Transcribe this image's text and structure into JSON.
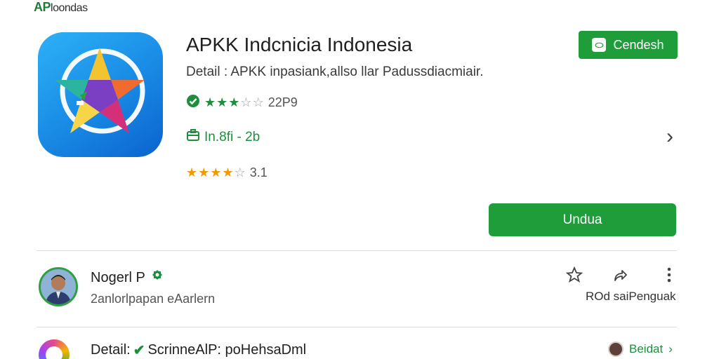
{
  "brand": {
    "accent": "AP",
    "rest": "loondas"
  },
  "app": {
    "title": "APKK Indcnicia Indonesia",
    "detail": "Detail : APKK inpasiank,allso llar Padussdiacmiair.",
    "rating1": {
      "stars_filled": 3,
      "stars_total": 5,
      "text": "22P9"
    },
    "info": "In.8fi - 2b",
    "rating2": {
      "stars_filled": 4,
      "stars_total": 5,
      "text": "3.1"
    }
  },
  "top_button": {
    "label": "Cendesh",
    "icon": "tag-icon"
  },
  "main_button": {
    "label": "Undua"
  },
  "developer": {
    "name": "Nogerl P",
    "subtitle": "2anlorlpapan eAarlern",
    "action_text": "ROd saiPenguak"
  },
  "bottom_row": {
    "prefix": "Detail:",
    "text": "ScrinneAlP: poHehsaDml",
    "right_label": "Beidat"
  },
  "colors": {
    "brand_green": "#1e9d3a",
    "star_orange": "#f29900",
    "icon_blue": "#1a8de6"
  }
}
